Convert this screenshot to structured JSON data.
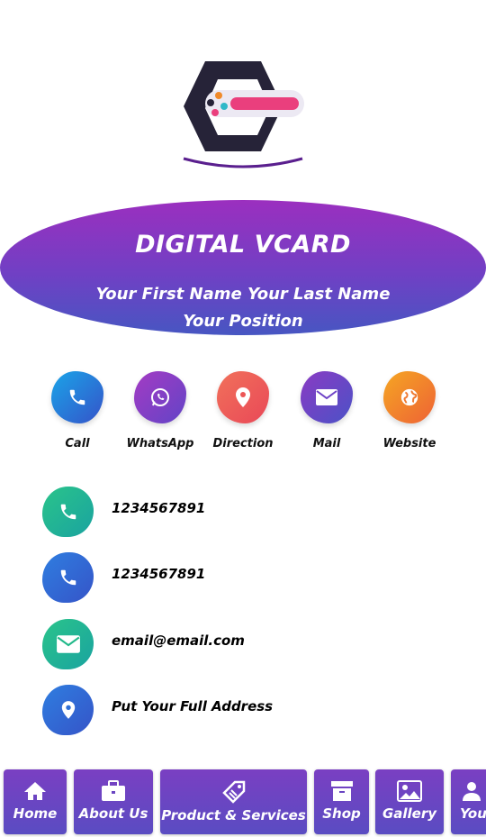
{
  "hero": {
    "brand": "DIGITAL VCARD",
    "name": "Your First Name Your Last Name",
    "position": "Your Position"
  },
  "actions": [
    {
      "label": "Call",
      "icon": "phone-icon",
      "color": "#2f6fd6"
    },
    {
      "label": "WhatsApp",
      "icon": "whatsapp-icon",
      "color": "#7f3ec6"
    },
    {
      "label": "Direction",
      "icon": "map-pin-icon",
      "color": "#ef5a50"
    },
    {
      "label": "Mail",
      "icon": "mail-icon",
      "color": "#6d42c6"
    },
    {
      "label": "Website",
      "icon": "globe-icon",
      "color": "#f07a2a"
    }
  ],
  "info": [
    {
      "text": "1234567891",
      "icon": "phone-icon",
      "color": "#22b98a"
    },
    {
      "text": "1234567891",
      "icon": "phone-icon",
      "color": "#2f6fd6"
    },
    {
      "text": "email@email.com",
      "icon": "mail-icon",
      "color": "#22b98a"
    },
    {
      "text": "Put Your Full Address",
      "icon": "map-pin-icon",
      "color": "#2f6fd6"
    }
  ],
  "nav": [
    {
      "label": "Home",
      "icon": "home-icon"
    },
    {
      "label": "About Us",
      "icon": "briefcase-icon"
    },
    {
      "label": "Product & Services",
      "icon": "tag-icon"
    },
    {
      "label": "Shop",
      "icon": "archive-icon"
    },
    {
      "label": "Gallery",
      "icon": "image-icon"
    },
    {
      "label": "You",
      "icon": "user-icon"
    }
  ],
  "colors": {
    "hero_top": "#9b2fbf",
    "hero_bottom": "#4756c2",
    "nav_bg": "#6a45c2",
    "logo_dark": "#262338",
    "logo_pink": "#ea3f7d",
    "logo_arc": "#5a1f8e"
  }
}
